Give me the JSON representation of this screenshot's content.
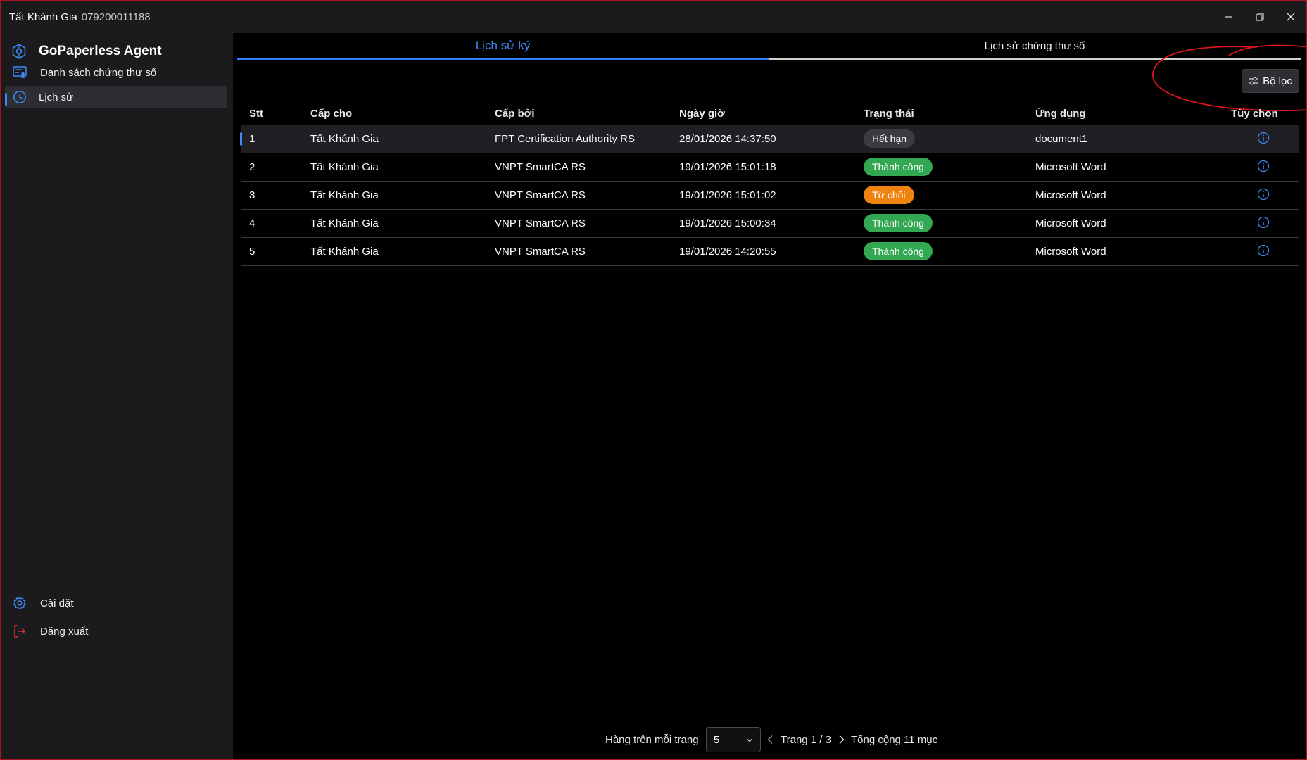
{
  "titlebar": {
    "user_name": "Tất Khánh Gia",
    "user_id": "079200011188",
    "minimize_glyph": "—",
    "restore_glyph": "❐",
    "close_glyph": "✕"
  },
  "sidebar": {
    "app_name": "GoPaperless Agent",
    "items": [
      {
        "label": "Danh sách chứng thư số",
        "icon": "certificate-list-icon"
      },
      {
        "label": "Lịch sử",
        "icon": "clock-icon",
        "active": true
      }
    ],
    "bottom_items": [
      {
        "label": "Cài đặt",
        "icon": "gear-icon"
      },
      {
        "label": "Đăng xuất",
        "icon": "logout-icon"
      }
    ]
  },
  "tabs": [
    {
      "label": "Lịch sử ký",
      "active": true
    },
    {
      "label": "Lịch sử chứng thư số",
      "active": false
    }
  ],
  "filter_button": {
    "label": "Bộ lọc"
  },
  "table": {
    "headers": [
      "Stt",
      "Cấp cho",
      "Cấp bởi",
      "Ngày giờ",
      "Trạng thái",
      "Ứng dụng",
      "Tùy chọn"
    ],
    "rows": [
      {
        "stt": "1",
        "to": "Tất Khánh Gia",
        "by": "FPT Certification Authority RS",
        "date": "28/01/2026 14:37:50",
        "status": "Hết hạn",
        "status_type": "expired",
        "app": "document1"
      },
      {
        "stt": "2",
        "to": "Tất Khánh Gia",
        "by": "VNPT SmartCA RS",
        "date": "19/01/2026 15:01:18",
        "status": "Thành công",
        "status_type": "success",
        "app": "Microsoft Word"
      },
      {
        "stt": "3",
        "to": "Tất Khánh Gia",
        "by": "VNPT SmartCA RS",
        "date": "19/01/2026 15:01:02",
        "status": "Từ chối",
        "status_type": "rejected",
        "app": "Microsoft Word"
      },
      {
        "stt": "4",
        "to": "Tất Khánh Gia",
        "by": "VNPT SmartCA RS",
        "date": "19/01/2026 15:00:34",
        "status": "Thành công",
        "status_type": "success",
        "app": "Microsoft Word"
      },
      {
        "stt": "5",
        "to": "Tất Khánh Gia",
        "by": "VNPT SmartCA RS",
        "date": "19/01/2026 14:20:55",
        "status": "Thành công",
        "status_type": "success",
        "app": "Microsoft Word"
      }
    ]
  },
  "pagination": {
    "rows_per_page_label": "Hàng trên mỗi trang",
    "rows_per_page": "5",
    "page_label": "Trang 1 / 3",
    "total_label": "Tổng cộng 11 mục"
  },
  "colors": {
    "accent": "#3d8bf7",
    "success": "#33a852",
    "rejected": "#f0820f",
    "expired": "#3b3b40",
    "annotation": "#d8141e"
  }
}
